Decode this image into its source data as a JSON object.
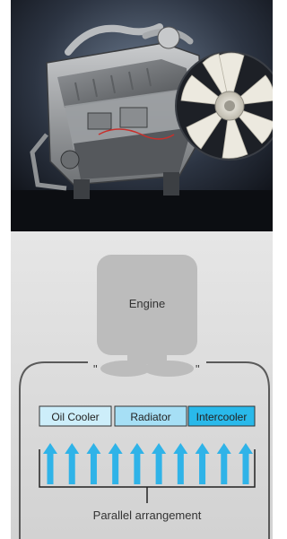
{
  "photo": {
    "subject_icon": "engine-with-cooling-fan"
  },
  "diagram": {
    "engine_label": "Engine",
    "coolers": [
      {
        "label": "Oil Cooler",
        "fill": "#cdeefa"
      },
      {
        "label": "Radiator",
        "fill": "#a6dff5"
      },
      {
        "label": "Intercooler",
        "fill": "#29b9ea"
      }
    ],
    "arrow_count": 10,
    "arrow_color": "#2fb3e8",
    "caption": "Parallel arrangement",
    "colors": {
      "panel": "#d8d8d8",
      "engine": "#bcbcbc",
      "outline": "#5a5a5a"
    }
  }
}
